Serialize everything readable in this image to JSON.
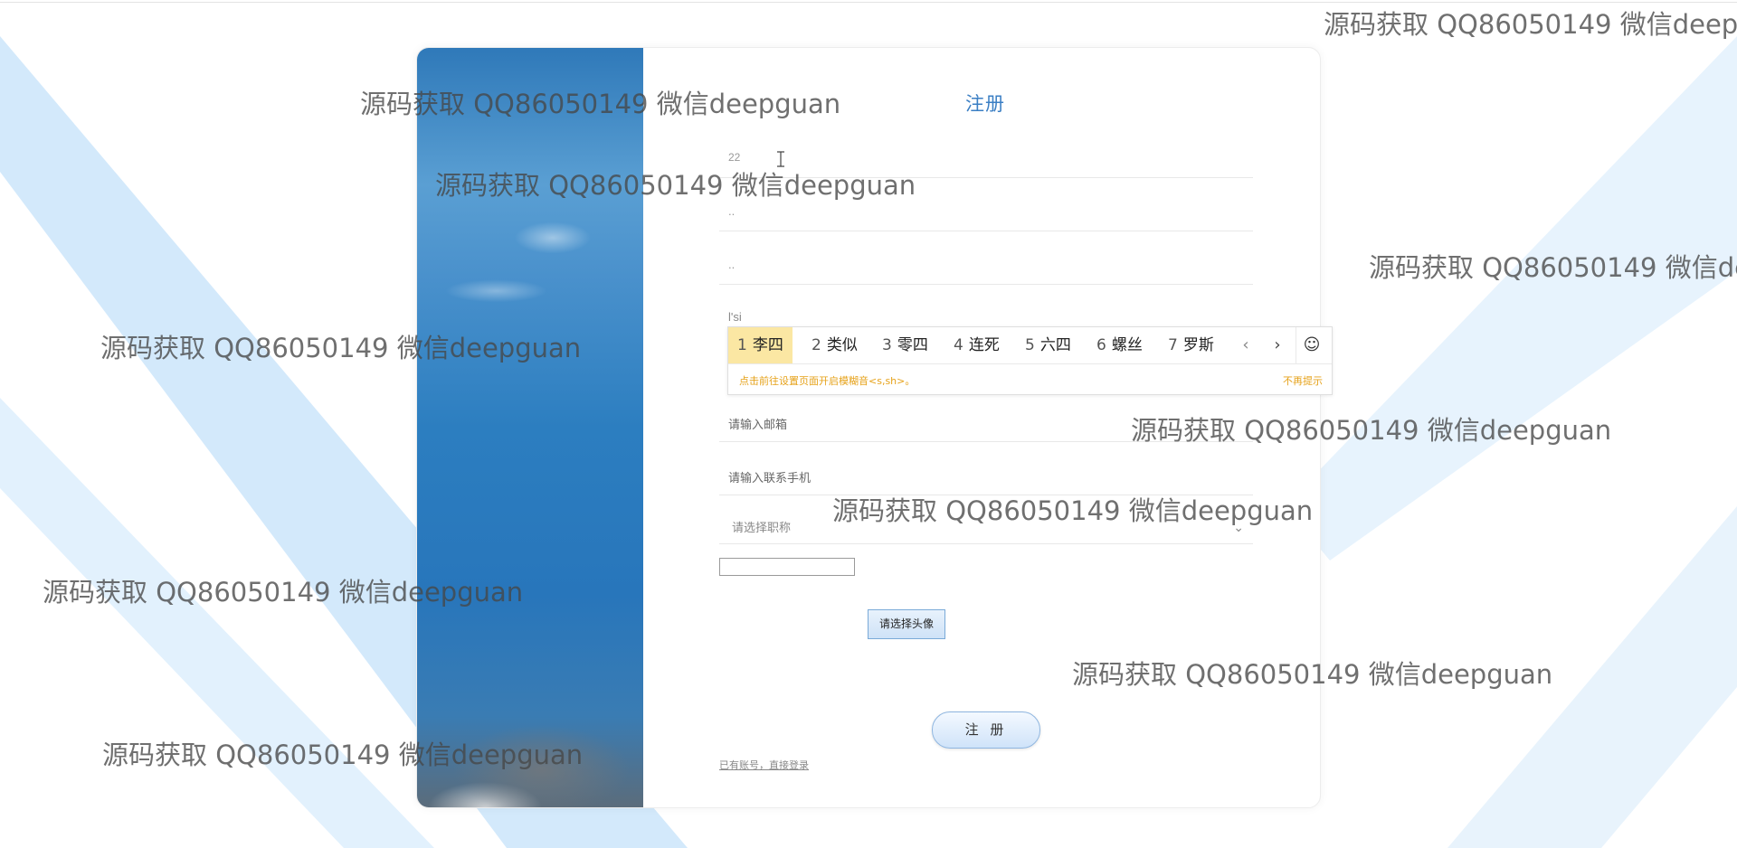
{
  "form": {
    "title": "注册",
    "fields": [
      {
        "value": "22"
      },
      {
        "value": ".."
      },
      {
        "value": ".."
      },
      {
        "value": "l'si"
      }
    ],
    "email_placeholder": "请输入邮箱",
    "phone_placeholder": "请输入联系手机",
    "title_select_placeholder": "请选择职称",
    "avatar_button": "请选择头像",
    "submit_button": "注 册",
    "login_link": "已有账号，直接登录"
  },
  "ime": {
    "candidates": [
      {
        "num": "1",
        "text": "李四"
      },
      {
        "num": "2",
        "text": "类似"
      },
      {
        "num": "3",
        "text": "零四"
      },
      {
        "num": "4",
        "text": "连死"
      },
      {
        "num": "5",
        "text": "六四"
      },
      {
        "num": "6",
        "text": "螺丝"
      },
      {
        "num": "7",
        "text": "罗斯"
      }
    ],
    "prev": "‹",
    "next": "›",
    "emoji": "☺",
    "hint": "点击前往设置页面开启模糊音<s,sh>。",
    "no_hint": "不再提示"
  },
  "watermark": {
    "text": "源码获取 QQ86050149 微信deepguan"
  },
  "colors": {
    "accent": "#3b7fc4",
    "ime_selected": "#fbe7a3",
    "hint": "#e6a21a",
    "stripe": "#cfe7f9"
  }
}
